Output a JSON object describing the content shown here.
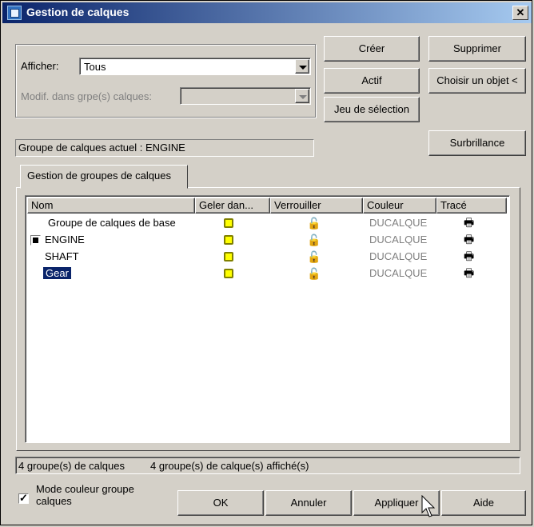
{
  "window": {
    "title": "Gestion de calques"
  },
  "filter": {
    "show_label": "Afficher:",
    "show_value": "Tous",
    "modify_label": "Modif. dans grpe(s) calques:",
    "modify_value": ""
  },
  "buttons": {
    "create": "Créer",
    "delete": "Supprimer",
    "active": "Actif",
    "pick_object": "Choisir un objet <",
    "selection_set": "Jeu de sélection",
    "highlight": "Surbrillance"
  },
  "current_group": "Groupe de calques actuel : ENGINE",
  "tab": {
    "label": "Gestion de groupes de calques"
  },
  "table": {
    "headers": [
      "Nom",
      "Geler dan...",
      "Verrouiller",
      "Couleur",
      "Tracé"
    ],
    "rows": [
      {
        "name": "Groupe de calques de base",
        "color": "DUCALQUE",
        "current": false,
        "selected": false
      },
      {
        "name": "ENGINE",
        "color": "DUCALQUE",
        "current": true,
        "selected": false
      },
      {
        "name": "SHAFT",
        "color": "DUCALQUE",
        "current": false,
        "selected": false
      },
      {
        "name": "Gear",
        "color": "DUCALQUE",
        "current": false,
        "selected": true
      }
    ]
  },
  "status": {
    "groups_count": "4 groupe(s) de calques",
    "groups_shown": "4 groupe(s) de calque(s) affiché(s)"
  },
  "options": {
    "color_mode_label": "Mode couleur groupe calques",
    "color_mode_checked": true
  },
  "footer": {
    "ok": "OK",
    "cancel": "Annuler",
    "apply": "Appliquer",
    "help": "Aide"
  },
  "colors": {
    "title_start": "#0a246a",
    "title_end": "#a6caf0",
    "selection": "#0a246a",
    "freeze": "#ffff00",
    "color_text": "#808080"
  },
  "icons": {
    "freeze": "sun-icon",
    "lock": "open-lock-icon",
    "plot": "printer-icon"
  }
}
